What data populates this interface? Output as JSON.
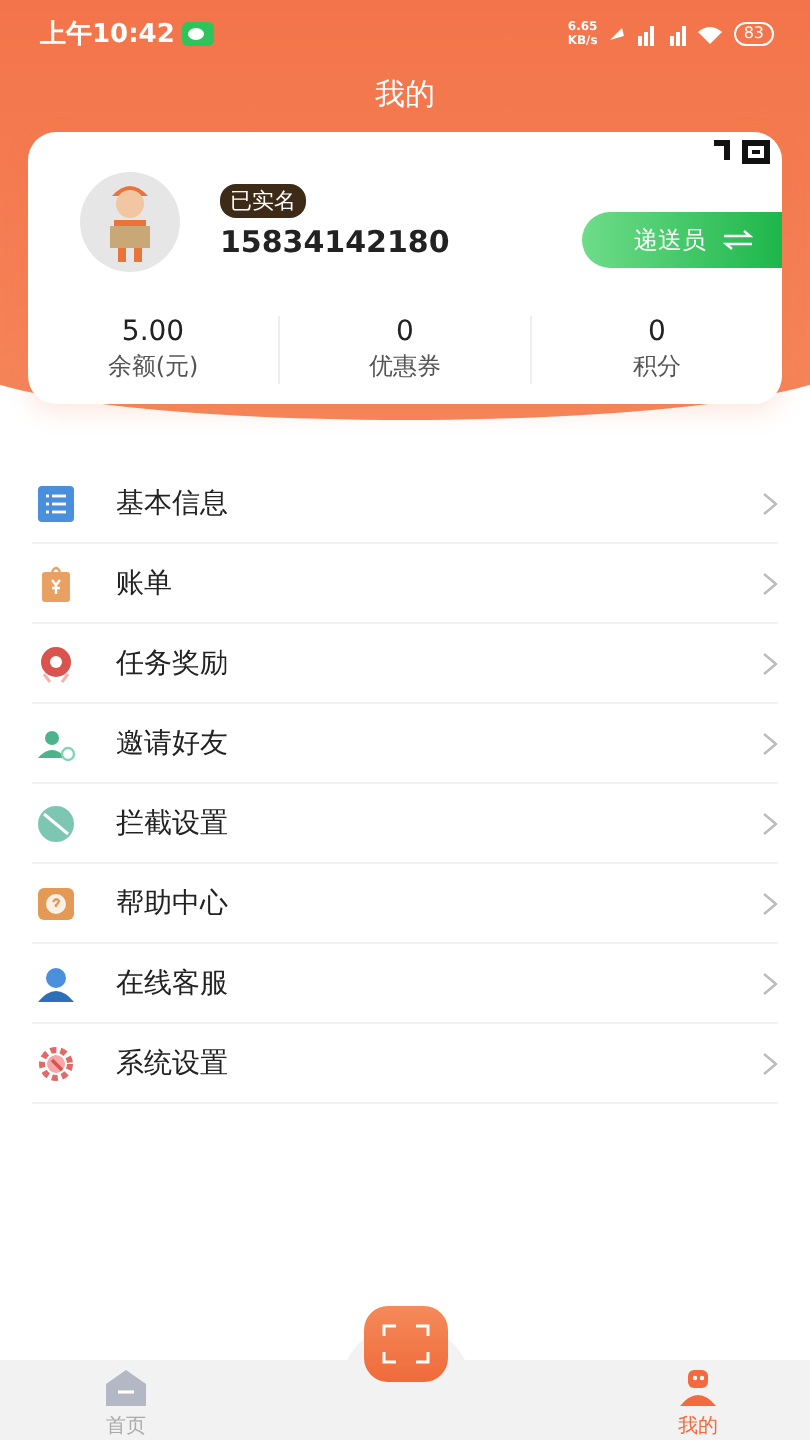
{
  "status_bar": {
    "time": "上午10:42",
    "net_speed": "6.65\nKB/s",
    "battery": "83"
  },
  "header": {
    "title": "我的"
  },
  "profile": {
    "badge": "已实名",
    "phone": "15834142180",
    "role_button": "递送员"
  },
  "stats": [
    {
      "value": "5.00",
      "label": "余额(元)"
    },
    {
      "value": "0",
      "label": "优惠券"
    },
    {
      "value": "0",
      "label": "积分"
    }
  ],
  "menu": [
    {
      "kind": "list",
      "label": "基本信息"
    },
    {
      "kind": "bill",
      "label": "账单"
    },
    {
      "kind": "reward",
      "label": "任务奖励"
    },
    {
      "kind": "invite",
      "label": "邀请好友"
    },
    {
      "kind": "block",
      "label": "拦截设置"
    },
    {
      "kind": "help",
      "label": "帮助中心"
    },
    {
      "kind": "service",
      "label": "在线客服"
    },
    {
      "kind": "settings",
      "label": "系统设置"
    }
  ],
  "tab_bar": [
    {
      "kind": "home",
      "label": "首页",
      "selected": false
    },
    {
      "kind": "me",
      "label": "我的",
      "selected": true
    }
  ]
}
